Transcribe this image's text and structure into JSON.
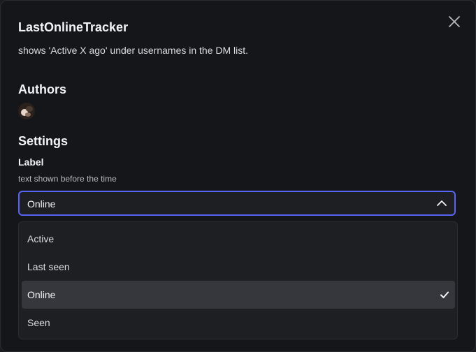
{
  "plugin": {
    "name": "LastOnlineTracker",
    "description": "shows 'Active X ago' under usernames in the DM list."
  },
  "sections": {
    "authors_heading": "Authors",
    "settings_heading": "Settings"
  },
  "setting": {
    "label": "Label",
    "help": "text shown before the time",
    "selected_value": "Online"
  },
  "options": [
    {
      "label": "Active",
      "selected": false
    },
    {
      "label": "Last seen",
      "selected": false
    },
    {
      "label": "Online",
      "selected": true
    },
    {
      "label": "Seen",
      "selected": false
    }
  ],
  "icons": {
    "close": "close-icon",
    "chevron": "chevron-up-icon",
    "check": "check-icon"
  },
  "colors": {
    "accent": "#5865f2",
    "modal_bg": "#151619",
    "menu_bg": "#1e1f22",
    "selected_bg": "#35373c"
  }
}
